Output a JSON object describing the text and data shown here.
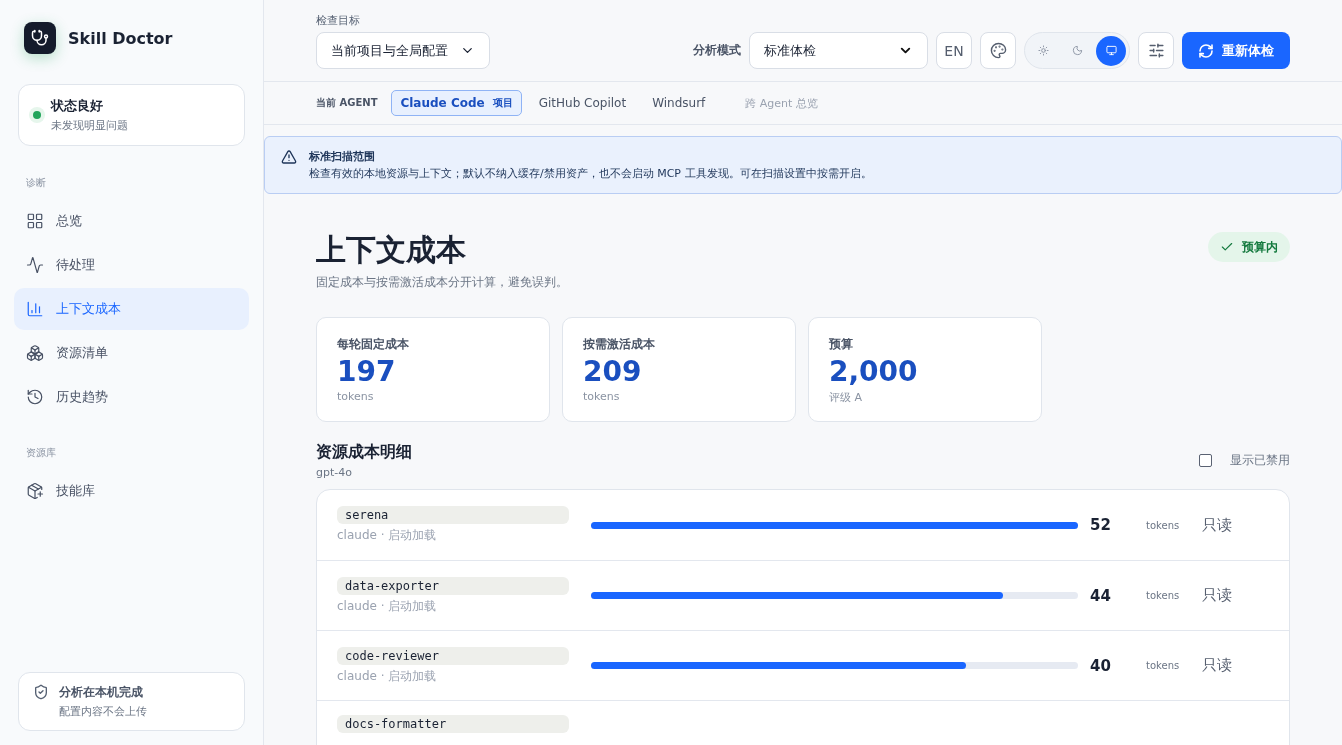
{
  "brand": {
    "name": "Skill Doctor"
  },
  "status": {
    "title": "状态良好",
    "subtitle": "未发现明显问题",
    "color": "#22a55b"
  },
  "sidebar": {
    "sections": [
      {
        "heading": "诊断",
        "items": [
          {
            "label": "总览",
            "selected": false
          },
          {
            "label": "待处理",
            "selected": false
          },
          {
            "label": "上下文成本",
            "selected": true
          },
          {
            "label": "资源清单",
            "selected": false
          },
          {
            "label": "历史趋势",
            "selected": false
          }
        ]
      },
      {
        "heading": "资源库",
        "items": [
          {
            "label": "技能库",
            "selected": false
          }
        ]
      }
    ],
    "footer": {
      "title": "分析在本机完成",
      "subtitle": "配置内容不会上传"
    }
  },
  "toolbar": {
    "target_label": "检查目标",
    "target_value": "当前项目与全局配置",
    "mode_label": "分析模式",
    "mode_value": "标准体检",
    "language": "EN",
    "theme_options": [
      {
        "selected": false
      },
      {
        "selected": false
      },
      {
        "selected": true
      }
    ],
    "rerun": "重新体检"
  },
  "agent_bar": {
    "label": "当前 AGENT",
    "tabs": [
      {
        "label": "Claude Code",
        "badge": "项目",
        "selected": true,
        "disabled": false
      },
      {
        "label": "GitHub Copilot",
        "selected": false,
        "disabled": false
      },
      {
        "label": "Windsurf",
        "selected": false,
        "disabled": false
      },
      {
        "label": "跨 Agent 总览",
        "selected": false,
        "disabled": true
      }
    ]
  },
  "notice": {
    "title": "标准扫描范围",
    "text": "检查有效的本地资源与上下文；默认不纳入缓存/禁用资产，也不会启动 MCP 工具发现。可在扫描设置中按需开启。"
  },
  "page": {
    "title": "上下文成本",
    "subtitle": "固定成本与按需激活成本分开计算，避免误判。",
    "badge": "预算内"
  },
  "stats": [
    {
      "label": "每轮固定成本",
      "value": "197",
      "unit": "tokens"
    },
    {
      "label": "按需激活成本",
      "value": "209",
      "unit": "tokens"
    },
    {
      "label": "预算",
      "value": "2,000",
      "unit": "评级 A"
    }
  ],
  "breakdown": {
    "title": "资源成本明细",
    "model": "gpt-4o",
    "show_disabled": {
      "label": "显示已禁用",
      "checked": false
    },
    "rows": [
      {
        "name": "serena",
        "source": "claude · 启动加载",
        "level": 1.0,
        "tokens": "52",
        "unit": "tokens",
        "access": "只读"
      },
      {
        "name": "data-exporter",
        "source": "claude · 启动加载",
        "level": 0.846,
        "tokens": "44",
        "unit": "tokens",
        "access": "只读"
      },
      {
        "name": "code-reviewer",
        "source": "claude · 启动加载",
        "level": 0.77,
        "tokens": "40",
        "unit": "tokens",
        "access": "只读"
      },
      {
        "name": "docs-formatter"
      }
    ]
  }
}
